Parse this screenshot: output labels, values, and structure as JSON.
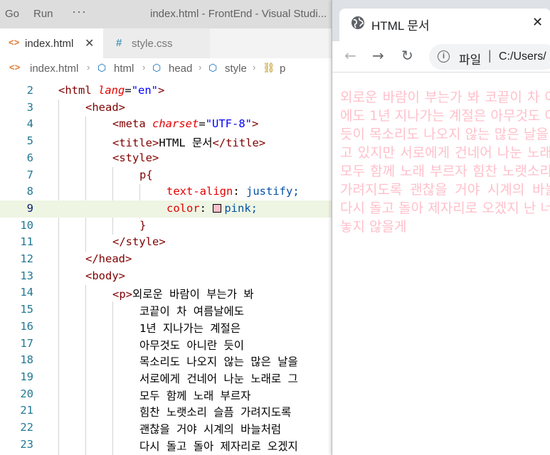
{
  "vscode": {
    "menu": [
      "Go",
      "Run",
      "···"
    ],
    "window_title": "index.html - FrontEnd - Visual Studi...",
    "tabs": [
      {
        "label": "index.html",
        "icon": "html-file-icon",
        "active": true
      },
      {
        "label": "style.css",
        "icon": "css-file-icon",
        "active": false
      }
    ],
    "breadcrumb": [
      "index.html",
      "html",
      "head",
      "style",
      "p"
    ],
    "gutter": [
      "2",
      "3",
      "4",
      "5",
      "6",
      "7",
      "8",
      "9",
      "10",
      "11",
      "12",
      "13",
      "14",
      "15",
      "16",
      "17",
      "18",
      "19",
      "20",
      "21",
      "22",
      "23"
    ],
    "current_line": "9",
    "code": {
      "l2_tag": "html",
      "l2_attr": "lang",
      "l2_val": "\"en\"",
      "l3_tag": "head",
      "l4_tag": "meta",
      "l4_attr": "charset",
      "l4_val": "\"UTF-8\"",
      "l5_tag": "title",
      "l5_text": "HTML 문서",
      "l6_tag": "style",
      "l7_sel": "p{",
      "l8_prop": "text-align",
      "l8_val": "justify;",
      "l9_prop": "color",
      "l9_val": "pink;",
      "l10": "}",
      "l11_tag": "style",
      "l12_tag": "head",
      "l13_tag": "body",
      "l14_tag": "p",
      "lyrics": [
        "외로운 바람이 부는가 봐",
        "코끝이 차 여름날에도",
        "1년 지나가는 계절은",
        "아무것도 아니란 듯이",
        "목소리도 나오지 않는 많은 날을",
        "서로에게 건네어 나눈 노래로 그",
        "모두 함께 노래 부르자",
        "힘찬 노랫소리 슬픔 가려지도록",
        "괜찮을 거야 시계의 바늘처럼",
        "다시 돌고 돌아 제자리로 오겠지"
      ]
    }
  },
  "browser": {
    "tab_title": "HTML 문서",
    "url_scheme": "파일",
    "url": "C:/Users/",
    "paragraph": "외로운 바람이 부는가 봐 코끝이 차 여름날에도 1년 지나가는 계절은 아무것도 아니란 듯이 목소리도 나오지 않는 많은 날을 숨 쉬고 있지만 서로에게 건네어 나눈 노래로 그 모두 함께 노래 부르자 힘찬 노랫소리 슬픔 가려지도록 괜찮을 거야 시계의 바늘처럼 다시 돌고 돌아 제자리로 오겠지 난 너의 손 놓지 않을게",
    "text_color": "#ffc0cb"
  }
}
